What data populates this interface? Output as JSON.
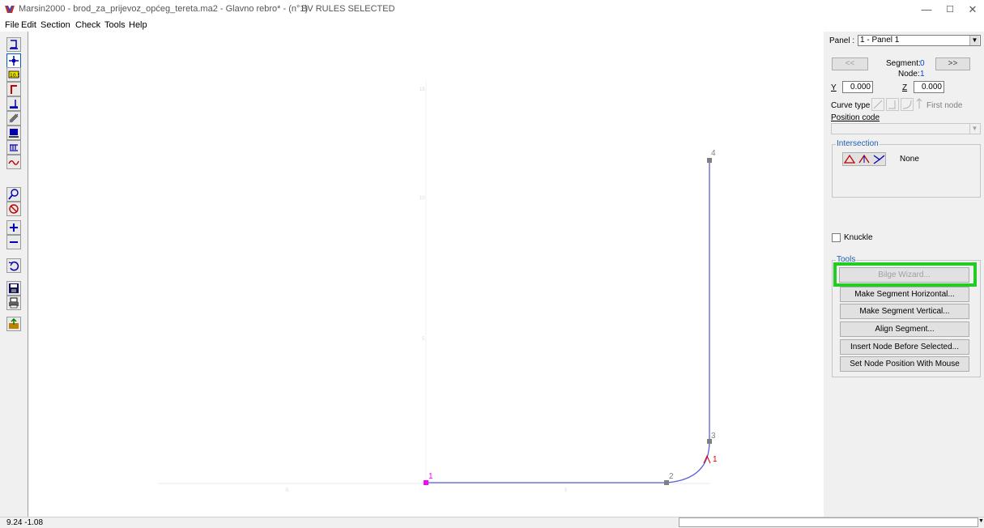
{
  "window": {
    "title": "Marsin2000 - brod_za_prijevoz_općeg_tereta.ma2 - Glavno rebro* - (n°1)",
    "status_title": "BV RULES SELECTED",
    "minimize": "—",
    "maximize": "☐",
    "close": "✕"
  },
  "menu": [
    "File",
    "Edit",
    "Section",
    "Check",
    "Tools",
    "Help"
  ],
  "toolbar_icons": [
    "frame-icon",
    "node-add-icon",
    "dimension-icon",
    "corner-icon",
    "plate-icon",
    "stiffener-icon",
    "section-view-icon",
    "list-icon",
    "curve-icon",
    "zoom-in-icon",
    "zoom-cancel-icon",
    "plus-icon",
    "minus-icon",
    "undo-icon",
    "save-icon",
    "print-icon",
    "export-icon"
  ],
  "canvas": {
    "nodes": [
      "1",
      "2",
      "3",
      "4"
    ],
    "segment_label": "1",
    "axis_faint": [
      "15",
      "10",
      "5",
      "-5",
      "5"
    ],
    "colors": {
      "segment": "#5b5fd6",
      "selected_node": "#ff00ff",
      "node": "#808080",
      "segment_label": "#e00000"
    }
  },
  "panel": {
    "label": "Panel :",
    "value": "1 - Panel 1",
    "prev_button": "<<",
    "next_button": ">>",
    "segment_label": "Segment:",
    "segment_value": "0",
    "node_label": "Node:",
    "node_value": "1",
    "y_label": "Y",
    "y_value": "0.000",
    "z_label": "Z",
    "z_value": "0.000",
    "curve_type_label": "Curve type",
    "first_node_label": "First node",
    "position_code_label": "Position code",
    "intersection_title": "Intersection",
    "intersection_value": "None",
    "knuckle_label": "Knuckle",
    "tools_title": "Tools",
    "buttons": [
      "Bilge Wizard...",
      "Make Segment Horizontal...",
      "Make Segment Vertical...",
      "Align Segment...",
      "Insert Node Before Selected...",
      "Set Node Position With Mouse"
    ],
    "highlight_color": "#22cc22"
  },
  "status": {
    "coords": "9.24 -1.08"
  }
}
